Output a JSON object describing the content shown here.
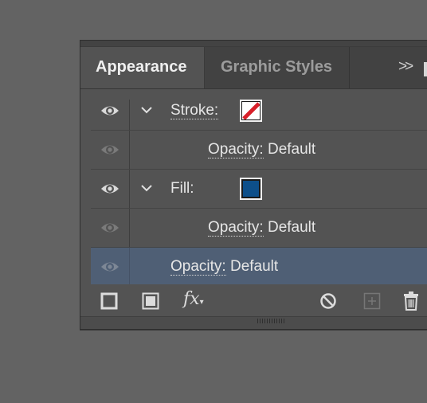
{
  "tabs": {
    "active": "Appearance",
    "inactive": "Graphic Styles",
    "more": ">>"
  },
  "rows": [
    {
      "label": "Stroke:",
      "type": "stroke",
      "value": ""
    },
    {
      "label": "Opacity:",
      "value": "Default"
    },
    {
      "label": "Fill:",
      "type": "fill",
      "value": ""
    },
    {
      "label": "Opacity:",
      "value": "Default"
    },
    {
      "label": "Opacity:",
      "value": "Default"
    }
  ],
  "colors": {
    "fill_swatch": "#0d4f8a",
    "stroke_slash": "#d8202a",
    "selection": "#4f5f75"
  },
  "toolbar_icons": [
    "add-stroke-icon",
    "add-fill-icon",
    "fx-icon",
    "clear-appearance-icon",
    "duplicate-item-icon",
    "delete-icon"
  ]
}
